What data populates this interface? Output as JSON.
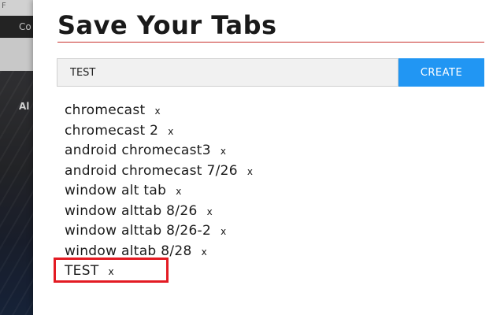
{
  "background": {
    "titlebar_text": "F",
    "nav_text": "Co",
    "hero_text": "Al"
  },
  "popup": {
    "title": "Save Your Tabs",
    "input": {
      "value": "TEST",
      "placeholder": ""
    },
    "create_label": "CREATE",
    "delete_glyph": "x",
    "tabs": [
      {
        "label": "chromecast"
      },
      {
        "label": "chromecast 2"
      },
      {
        "label": "android chromecast3"
      },
      {
        "label": "android chromecast 7/26"
      },
      {
        "label": "window alt tab"
      },
      {
        "label": "window alttab 8/26"
      },
      {
        "label": "window alttab 8/26-2"
      },
      {
        "label": "window altab 8/28"
      },
      {
        "label": "TEST"
      }
    ]
  },
  "colors": {
    "accent": "#2196f3",
    "rule": "#c9302c",
    "highlight": "#e31b23"
  }
}
